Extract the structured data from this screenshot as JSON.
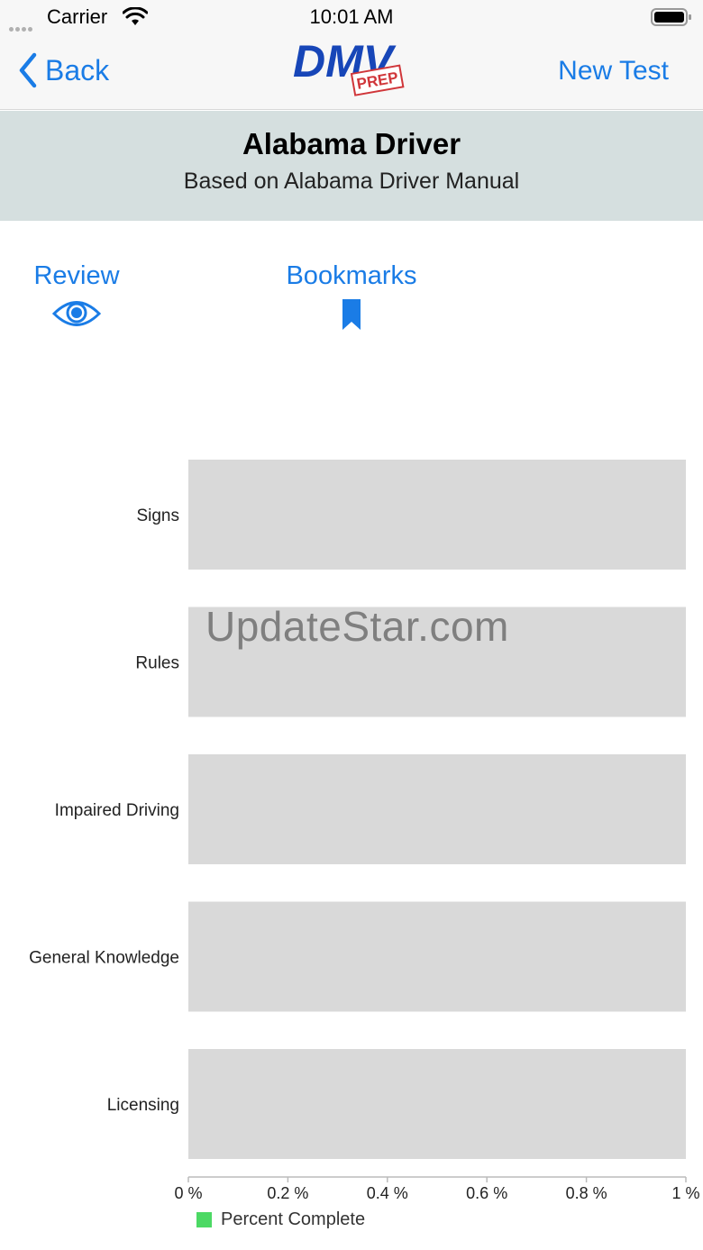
{
  "status_bar": {
    "carrier": "Carrier",
    "time": "10:01 AM"
  },
  "nav": {
    "back_label": "Back",
    "new_test_label": "New Test",
    "logo_main": "DMV",
    "logo_sub": "PREP"
  },
  "header": {
    "title": "Alabama Driver",
    "subtitle": "Based on Alabama Driver Manual"
  },
  "actions": {
    "review_label": "Review",
    "bookmarks_label": "Bookmarks"
  },
  "colors": {
    "accent": "#1a7ce6",
    "bar_track": "#d9d9d9",
    "header_bg": "#d5dfdf",
    "series": "#4cd964"
  },
  "chart_data": {
    "type": "bar",
    "orientation": "horizontal",
    "categories": [
      "Signs",
      "Rules",
      "Impaired Driving",
      "General Knowledge",
      "Licensing"
    ],
    "series": [
      {
        "name": "Percent Complete",
        "values": [
          0,
          0,
          0,
          0,
          0
        ]
      }
    ],
    "x_ticks": [
      "0 %",
      "0.2 %",
      "0.4 %",
      "0.6 %",
      "0.8 %",
      "1 %"
    ],
    "xlim": [
      0,
      1
    ],
    "legend_position": "bottom-left"
  },
  "watermark": "UpdateStar.com"
}
